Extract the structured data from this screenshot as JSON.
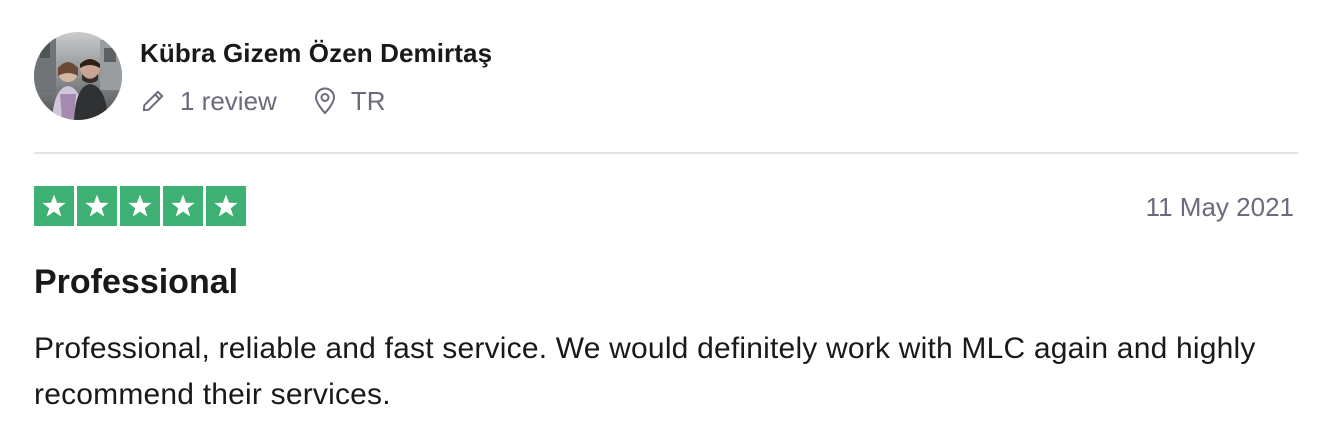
{
  "reviewer": {
    "name": "Kübra Gizem Özen Demirtaş",
    "review_count": "1 review",
    "location": "TR"
  },
  "review": {
    "rating": 5,
    "max_rating": 5,
    "star_color": "#3eb074",
    "date": "11 May 2021",
    "title": "Professional",
    "body": "Professional, reliable and fast service. We would definitely work with MLC again and highly recommend their services."
  },
  "icons": {
    "review_count": "pencil-icon",
    "location": "location-pin-icon"
  }
}
